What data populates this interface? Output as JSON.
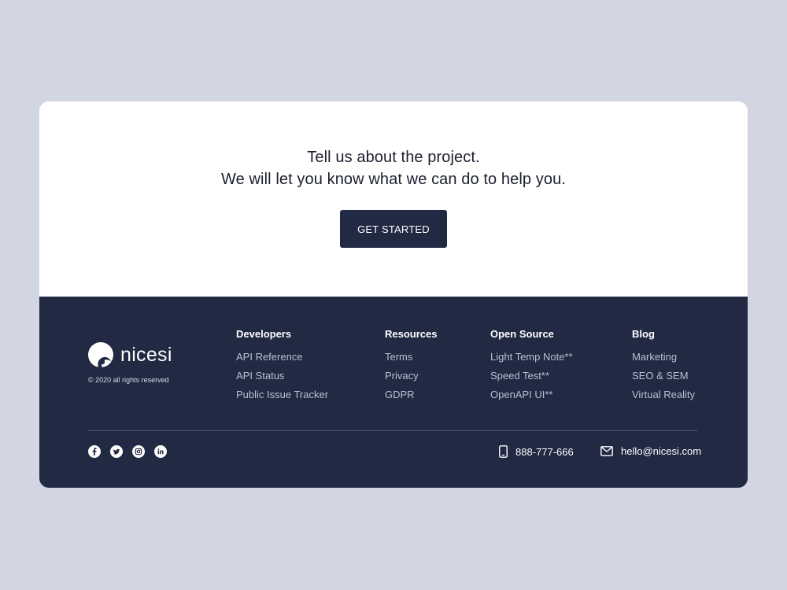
{
  "cta": {
    "line1": "Tell us about the project.",
    "line2": "We will let you know what we can do to help you.",
    "button_label": "GET STARTED"
  },
  "brand": {
    "name": "nicesi",
    "copyright": "© 2020 all rights reserved",
    "logo_icon": "nicesi-logo"
  },
  "columns": {
    "developers": {
      "title": "Developers",
      "links": [
        "API Reference",
        "API Status",
        "Public Issue Tracker"
      ]
    },
    "resources": {
      "title": "Resources",
      "links": [
        "Terms",
        "Privacy",
        "GDPR"
      ]
    },
    "open_source": {
      "title": "Open Source",
      "links": [
        "Light Temp Note**",
        "Speed Test**",
        "OpenAPI UI**"
      ]
    },
    "blog": {
      "title": "Blog",
      "links": [
        "Marketing",
        "SEO & SEM",
        "Virtual Reality"
      ]
    }
  },
  "social": [
    "facebook-icon",
    "twitter-icon",
    "instagram-icon",
    "linkedin-icon"
  ],
  "contact": {
    "phone": "888-777-666",
    "email": "hello@nicesi.com"
  },
  "colors": {
    "page_bg": "#d2d6e2",
    "card_bg": "#ffffff",
    "footer_bg": "#212943",
    "link_text": "#b9bfd3"
  }
}
